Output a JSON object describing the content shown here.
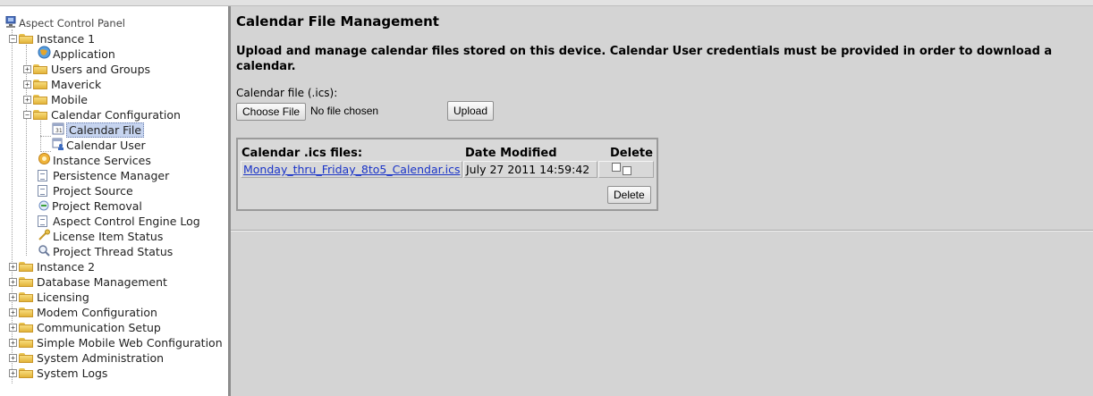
{
  "sidebar": {
    "root": "Aspect Control Panel",
    "instance1": "Instance 1",
    "application": "Application",
    "users_groups": "Users and Groups",
    "maverick": "Maverick",
    "mobile": "Mobile",
    "calendar_config": "Calendar Configuration",
    "calendar_file": "Calendar File",
    "calendar_user": "Calendar User",
    "instance_services": "Instance Services",
    "persistence_manager": "Persistence Manager",
    "project_source": "Project Source",
    "project_removal": "Project Removal",
    "engine_log": "Aspect Control Engine Log",
    "license_item_status": "License Item Status",
    "project_thread_status": "Project Thread Status",
    "instance2": "Instance 2",
    "database_management": "Database Management",
    "licensing": "Licensing",
    "modem_configuration": "Modem Configuration",
    "communication_setup": "Communication Setup",
    "simple_mobile": "Simple Mobile Web Configuration",
    "system_administration": "System Administration",
    "system_logs": "System Logs"
  },
  "main": {
    "title": "Calendar File Management",
    "description": "Upload and manage calendar files stored on this device. Calendar User credentials must be provided in order to download a calendar.",
    "file_label": "Calendar file (.ics):",
    "choose_file": "Choose File",
    "no_file": "No file chosen",
    "upload": "Upload",
    "table": {
      "col_files": "Calendar .ics files:",
      "col_date": "Date Modified",
      "col_delete": "Delete",
      "rows": [
        {
          "file": "Monday_thru_Friday_8to5_Calendar.ics",
          "date": "July 27 2011 14:59:42"
        }
      ],
      "delete_button": "Delete"
    }
  }
}
